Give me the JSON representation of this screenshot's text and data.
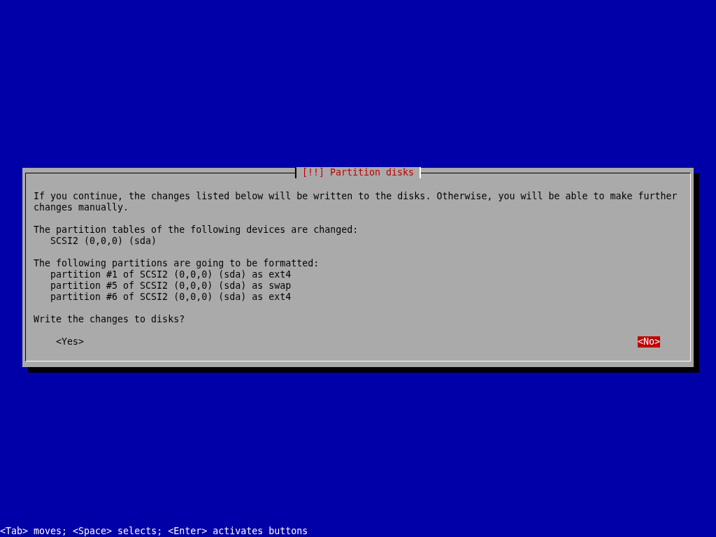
{
  "dialog": {
    "title": "[!!] Partition disks",
    "intro": "If you continue, the changes listed below will be written to the disks. Otherwise, you will be able to make further changes manually.",
    "sections": [
      {
        "heading": "The partition tables of the following devices are changed:",
        "items": [
          "SCSI2 (0,0,0) (sda)"
        ]
      },
      {
        "heading": "The following partitions are going to be formatted:",
        "items": [
          "partition #1 of SCSI2 (0,0,0) (sda) as ext4",
          "partition #5 of SCSI2 (0,0,0) (sda) as swap",
          "partition #6 of SCSI2 (0,0,0) (sda) as ext4"
        ]
      }
    ],
    "question": "Write the changes to disks?",
    "buttons": [
      {
        "label": "<Yes>",
        "selected": false
      },
      {
        "label": "<No>",
        "selected": true
      }
    ]
  },
  "status_bar": "<Tab> moves; <Space> selects; <Enter> activates buttons"
}
